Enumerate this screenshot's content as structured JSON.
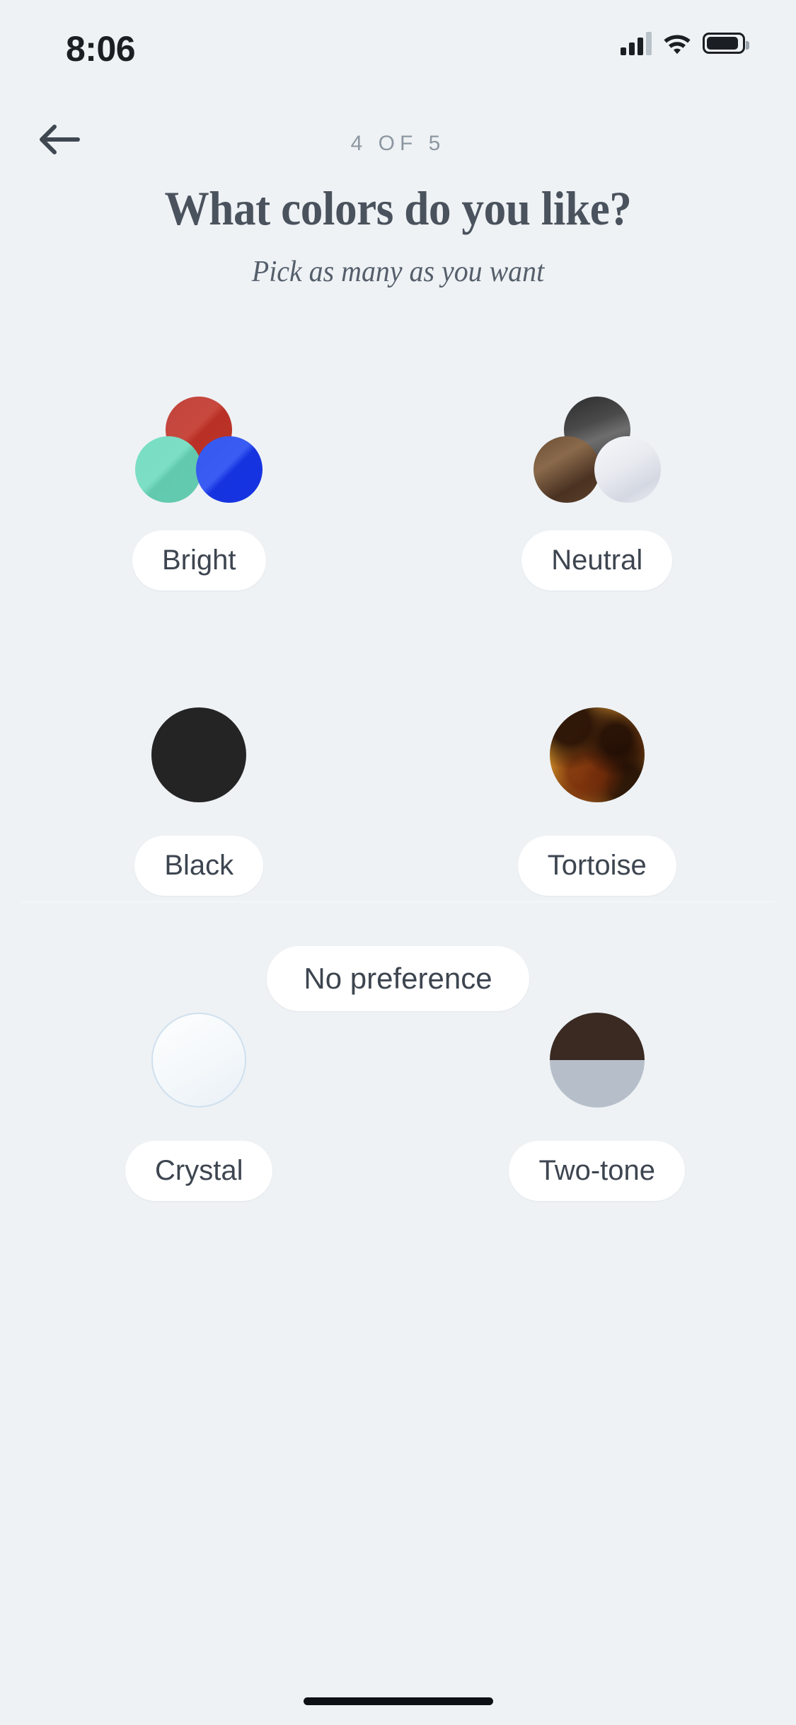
{
  "status_bar": {
    "time": "8:06",
    "cellular_icon": "cellular-signal-icon",
    "wifi_icon": "wifi-icon",
    "battery_icon": "battery-full-icon"
  },
  "header": {
    "back_icon": "back-arrow-icon",
    "step_label": "4 OF 5",
    "title": "What colors do you like?",
    "subtitle": "Pick as many as you want"
  },
  "options": [
    {
      "label": "Bright",
      "swatch": "three-circle-cluster-bright",
      "colors": [
        "#c3463b",
        "#6fd5bb",
        "#2246ea"
      ]
    },
    {
      "label": "Neutral",
      "swatch": "three-circle-cluster-neutral",
      "colors": [
        "#3a3a3a",
        "#6b4d34",
        "#e8eaf0"
      ]
    },
    {
      "label": "Black",
      "swatch": "solid-circle-black",
      "colors": [
        "#242424"
      ]
    },
    {
      "label": "Tortoise",
      "swatch": "pattern-circle-tortoise",
      "colors": [
        "#d9a23e",
        "#7a3f12",
        "#281206"
      ]
    },
    {
      "label": "Crystal",
      "swatch": "solid-circle-crystal",
      "colors": [
        "#f7fafc"
      ]
    },
    {
      "label": "Two-tone",
      "swatch": "split-circle-two-tone",
      "colors": [
        "#3a2a22",
        "#b6bfc9"
      ]
    }
  ],
  "footer": {
    "no_preference_label": "No preference"
  },
  "theme": {
    "background": "#eef2f5",
    "pill_background": "#ffffff",
    "text_primary": "#3d4550",
    "text_heading": "#4a525d",
    "text_muted": "#8d97a1"
  }
}
